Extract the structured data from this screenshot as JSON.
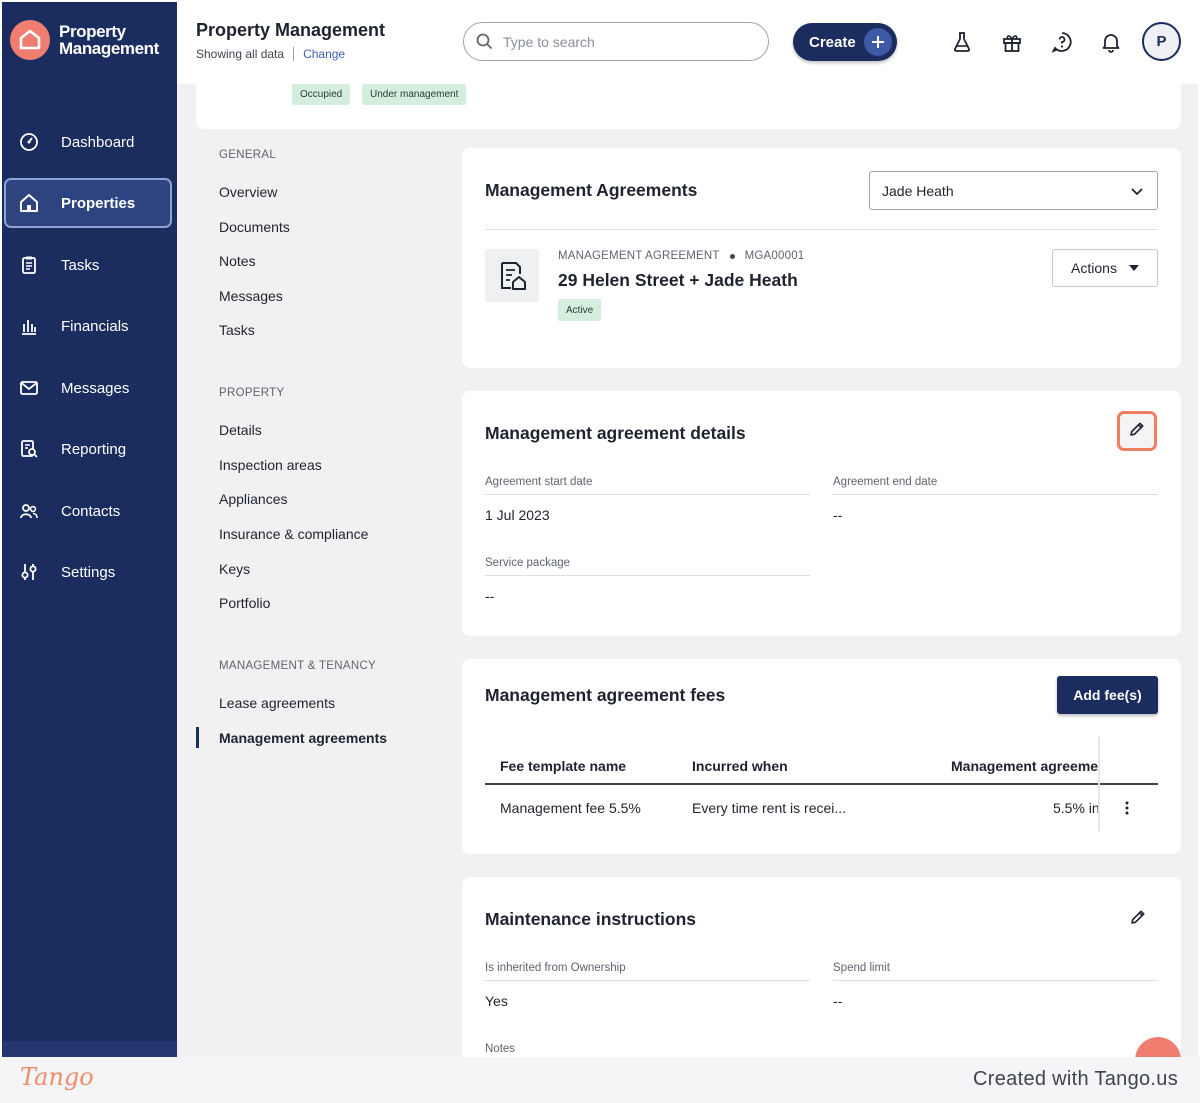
{
  "app": {
    "brand_line1": "Property",
    "brand_line2": "Management"
  },
  "sidebar": {
    "items": [
      {
        "label": "Dashboard",
        "icon": "dashboard-icon"
      },
      {
        "label": "Properties",
        "icon": "home-icon",
        "active": true
      },
      {
        "label": "Tasks",
        "icon": "clipboard-icon"
      },
      {
        "label": "Financials",
        "icon": "bank-icon"
      },
      {
        "label": "Messages",
        "icon": "mail-icon"
      },
      {
        "label": "Reporting",
        "icon": "report-icon"
      },
      {
        "label": "Contacts",
        "icon": "people-icon"
      },
      {
        "label": "Settings",
        "icon": "sliders-icon"
      }
    ]
  },
  "header": {
    "title": "Property Management",
    "subtitle": "Showing all data",
    "change_link": "Change",
    "search_placeholder": "Type to search",
    "create_label": "Create",
    "avatar_initial": "P"
  },
  "property_tags": [
    "Occupied",
    "Under management"
  ],
  "subnav": {
    "general_heading": "GENERAL",
    "general_items": [
      "Overview",
      "Documents",
      "Notes",
      "Messages",
      "Tasks"
    ],
    "property_heading": "PROPERTY",
    "property_items": [
      "Details",
      "Inspection areas",
      "Appliances",
      "Insurance & compliance",
      "Keys",
      "Portfolio"
    ],
    "tenancy_heading": "MANAGEMENT & TENANCY",
    "tenancy_items": [
      "Lease agreements",
      "Management agreements"
    ]
  },
  "agreements_card": {
    "title": "Management Agreements",
    "selected_owner": "Jade Heath",
    "type_label": "MANAGEMENT AGREEMENT",
    "agreement_id": "MGA00001",
    "agreement_name": "29 Helen Street + Jade Heath",
    "status": "Active",
    "actions_label": "Actions"
  },
  "details_card": {
    "title": "Management agreement details",
    "start_date_label": "Agreement start date",
    "start_date_value": "1 Jul 2023",
    "end_date_label": "Agreement end date",
    "end_date_value": "--",
    "service_package_label": "Service package",
    "service_package_value": "--"
  },
  "fees_card": {
    "title": "Management agreement fees",
    "add_label": "Add fee(s)",
    "columns": [
      "Fee template name",
      "Incurred when",
      "Management agreeme"
    ],
    "rows": [
      {
        "name": "Management fee 5.5%",
        "incurred": "Every time rent is recei...",
        "amount": "5.5% in"
      }
    ]
  },
  "maintenance_card": {
    "title": "Maintenance instructions",
    "inherited_label": "Is inherited from Ownership",
    "inherited_value": "Yes",
    "spend_limit_label": "Spend limit",
    "spend_limit_value": "--",
    "notes_label": "Notes"
  },
  "footer": {
    "logo": "Tango",
    "credit": "Created with Tango.us"
  },
  "colors": {
    "sidebar": "#1b2c5e",
    "accent": "#ef7e70",
    "tag_bg": "#d4eedd",
    "highlight": "#ef7e62"
  }
}
